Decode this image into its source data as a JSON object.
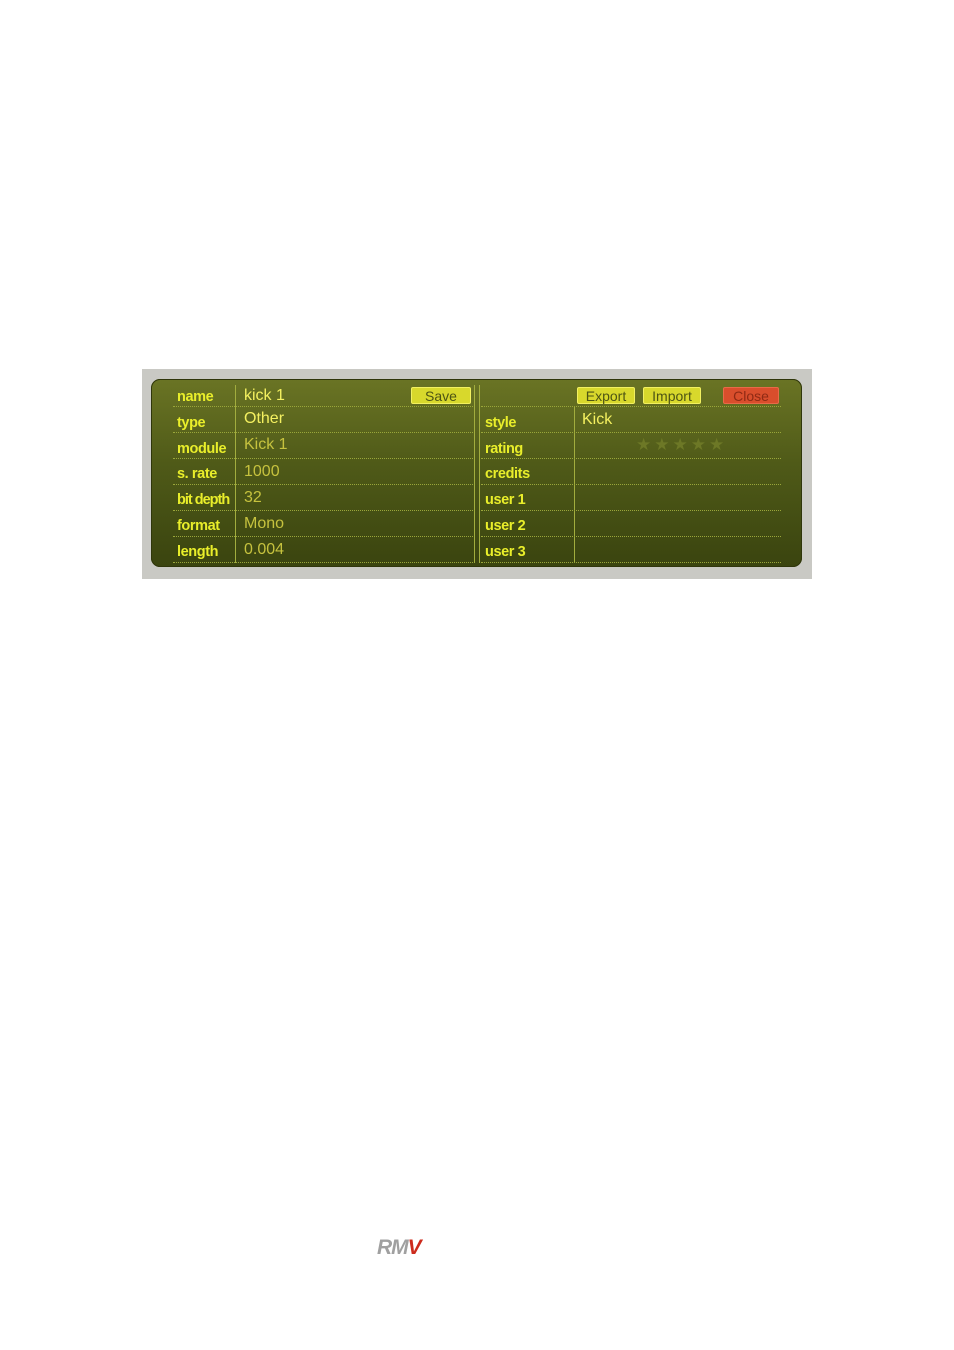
{
  "left_fields": [
    {
      "label": "name",
      "value": "kick 1"
    },
    {
      "label": "type",
      "value": "Other"
    },
    {
      "label": "module",
      "value": "Kick 1"
    },
    {
      "label": "s. rate",
      "value": "1000"
    },
    {
      "label": "bit depth",
      "value": "32"
    },
    {
      "label": "format",
      "value": "Mono"
    },
    {
      "label": "length",
      "value": "0.004"
    }
  ],
  "right_fields": [
    {
      "label": "style",
      "value": "Kick"
    },
    {
      "label": "rating",
      "value": ""
    },
    {
      "label": "credits",
      "value": ""
    },
    {
      "label": "user 1",
      "value": ""
    },
    {
      "label": "user 2",
      "value": ""
    },
    {
      "label": "user 3",
      "value": ""
    }
  ],
  "buttons": {
    "save": "Save",
    "export": "Export",
    "import": "Import",
    "close": "Close"
  },
  "rating": {
    "value": 0,
    "max": 5,
    "icon": "star-icon"
  },
  "colors": {
    "panel": "#4f5a18",
    "label": "#e9ee2a",
    "value": "#f4f060",
    "button": "#d8d82c",
    "close": "#d94e2c"
  },
  "logo": {
    "part1": "RM",
    "part2": "V"
  }
}
